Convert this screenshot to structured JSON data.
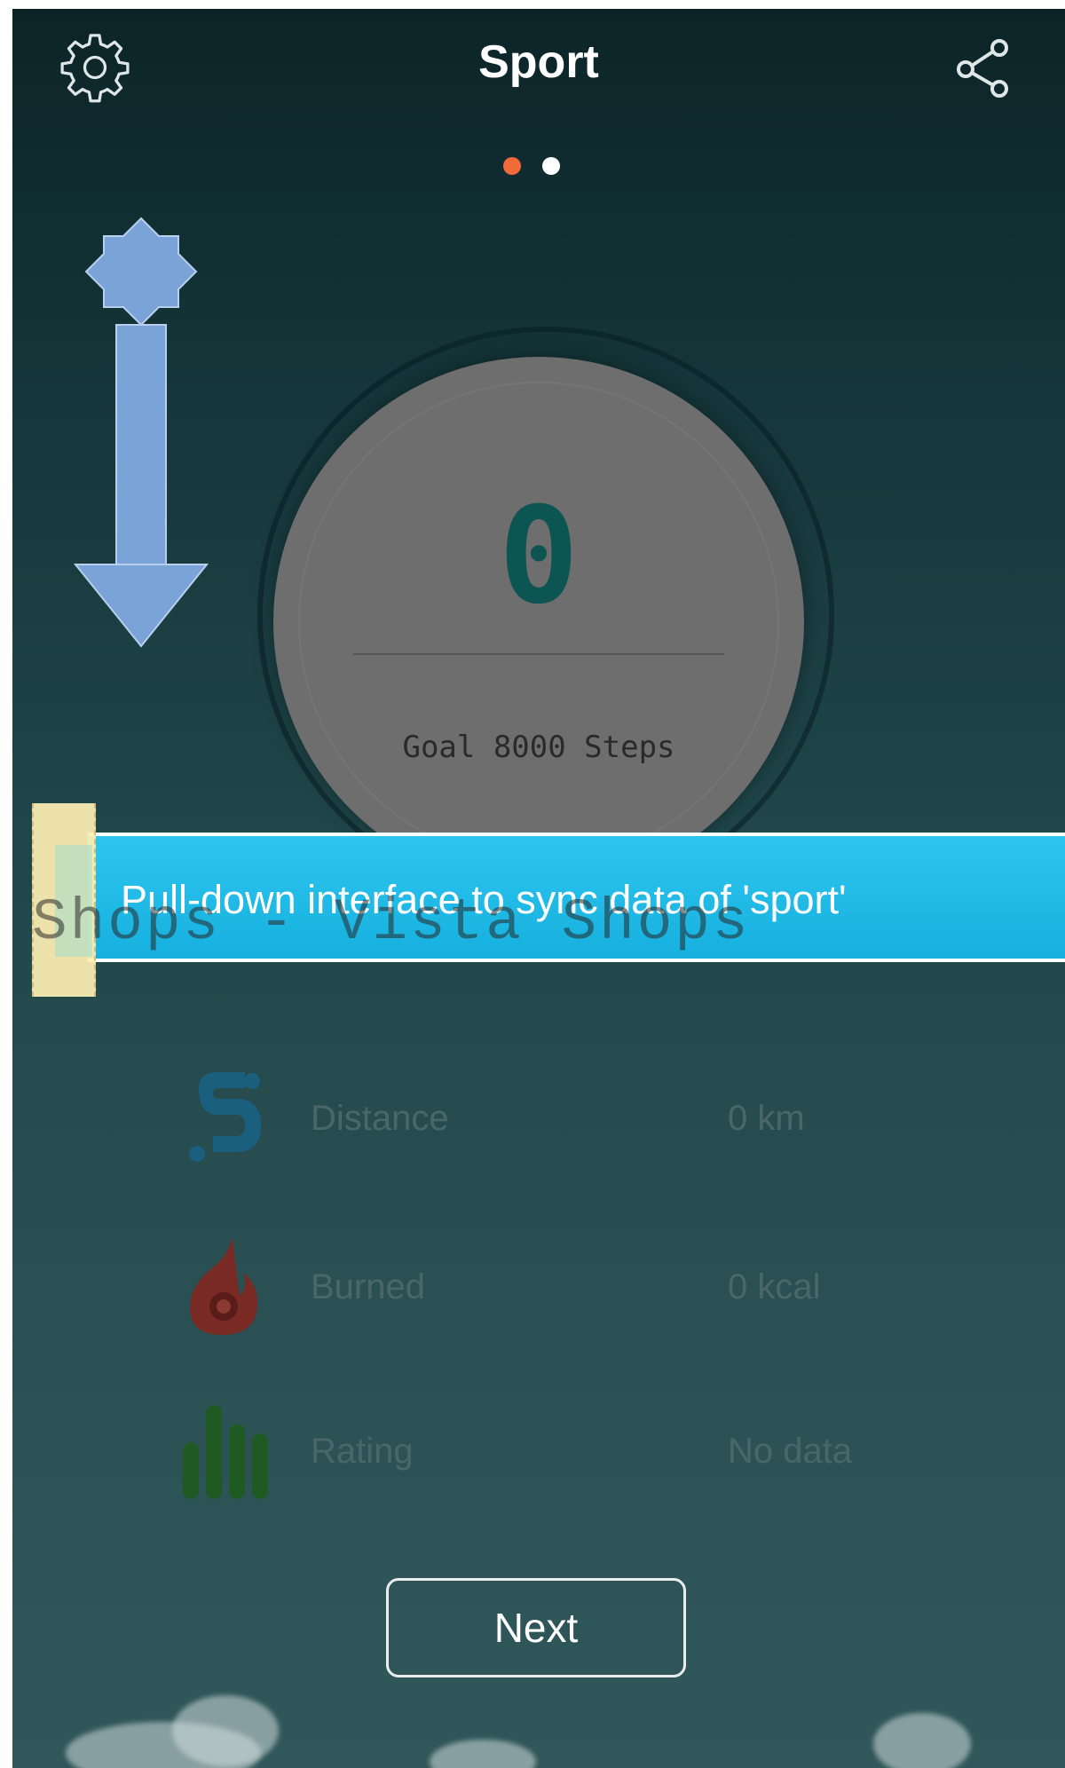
{
  "header": {
    "title": "Sport",
    "settings_icon": "gear-icon",
    "share_icon": "share-icon"
  },
  "pager": {
    "active_index": 0,
    "count": 2,
    "active_color": "#f06a3a",
    "inactive_color": "#ffffff"
  },
  "overlay_hint": {
    "arrow_icon": "up-down-arrow-icon",
    "banner_text": "Pull-down interface to sync data of 'sport'",
    "watermark_text": "Shops - Vista Shops",
    "banner_color": "#1bb8e4"
  },
  "step_dial": {
    "steps": "0",
    "goal_text": "Goal 8000 Steps",
    "digit_color": "#0d5552"
  },
  "stats": [
    {
      "icon": "distance-icon",
      "label": "Distance",
      "value": "0 km"
    },
    {
      "icon": "flame-icon",
      "label": "Burned",
      "value": "0 kcal"
    },
    {
      "icon": "rating-bars-icon",
      "label": "Rating",
      "value": "No data"
    }
  ],
  "actions": {
    "next_label": "Next"
  }
}
